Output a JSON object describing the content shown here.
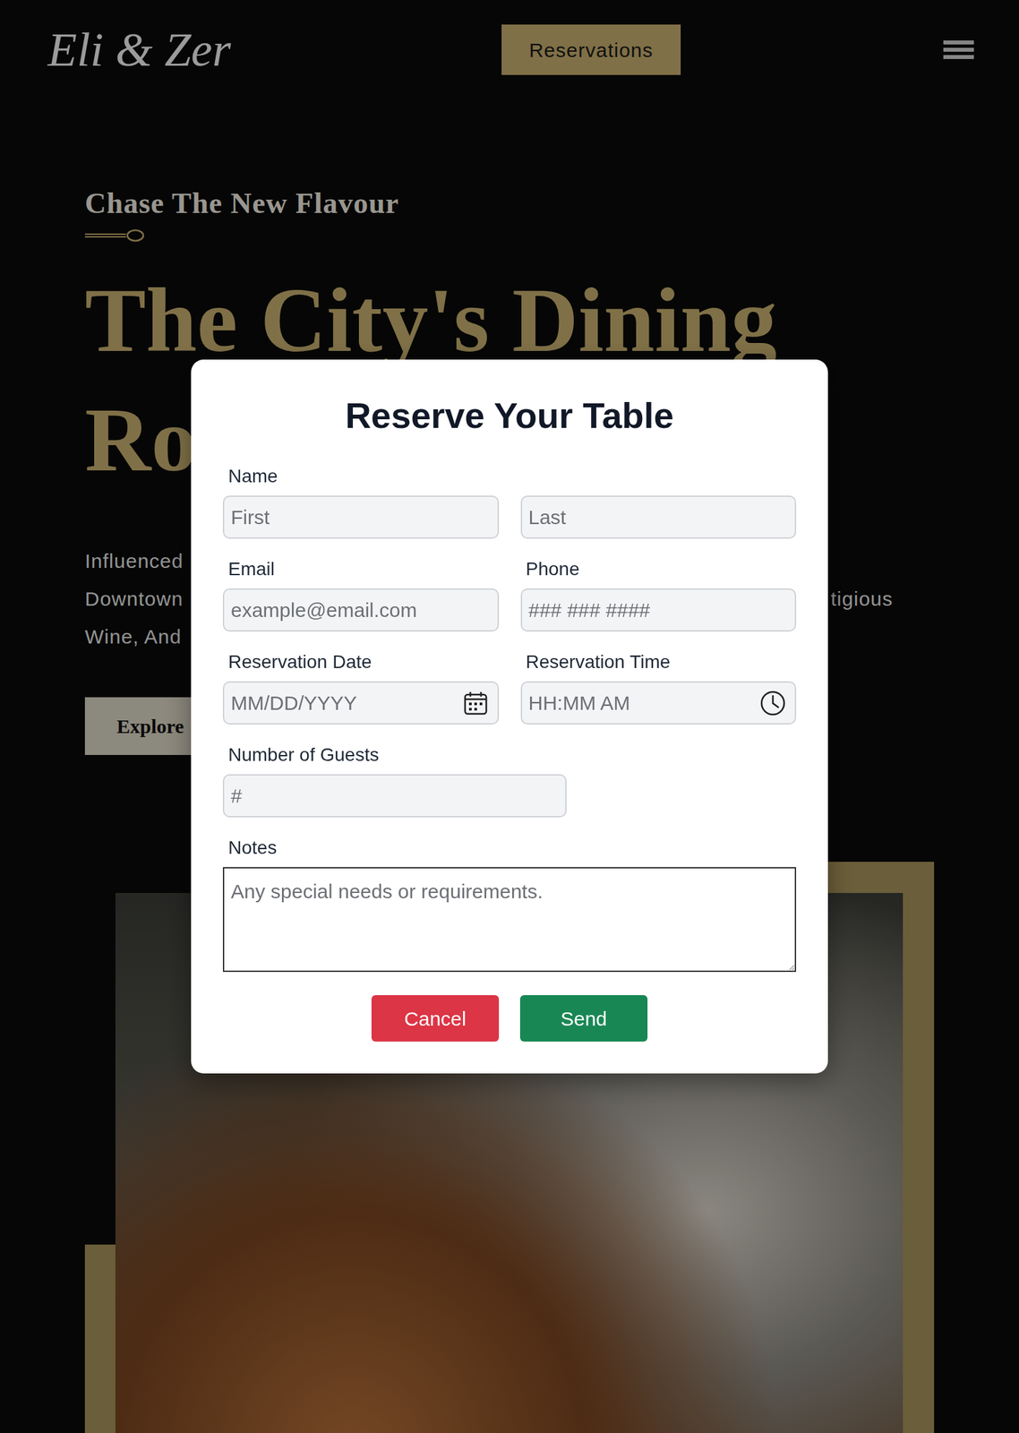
{
  "header": {
    "logo": "Eli & Zer",
    "reserve_button": "Reservations"
  },
  "hero": {
    "eyebrow": "Chase The New Flavour",
    "heading_lines": [
      "The City's Dining",
      "Ro"
    ],
    "paragraph_lines": [
      [
        "Influenced"
      ],
      [
        "Downtown",
        "tigious"
      ],
      [
        "Wine, And"
      ]
    ],
    "explore_button": "Explore"
  },
  "modal": {
    "title": "Reserve Your Table",
    "name": {
      "label": "Name",
      "first_placeholder": "First",
      "last_placeholder": "Last"
    },
    "fields": [
      {
        "label": "Email",
        "placeholder": "example@email.com",
        "kind": "email"
      },
      {
        "label": "Phone",
        "placeholder": "### ### ####",
        "kind": "tel"
      },
      {
        "label": "Reservation Date",
        "placeholder": "MM/DD/YYYY",
        "kind": "date"
      },
      {
        "label": "Reservation Time",
        "placeholder": "HH:MM AM",
        "kind": "time"
      },
      {
        "label": "Number of Guests",
        "placeholder": "#",
        "kind": "number"
      }
    ],
    "notes": {
      "label": "Notes",
      "placeholder": "Any special needs or requirements."
    },
    "buttons": [
      {
        "label": "Cancel",
        "kind": "cancel"
      },
      {
        "label": "Send",
        "kind": "send"
      }
    ]
  }
}
